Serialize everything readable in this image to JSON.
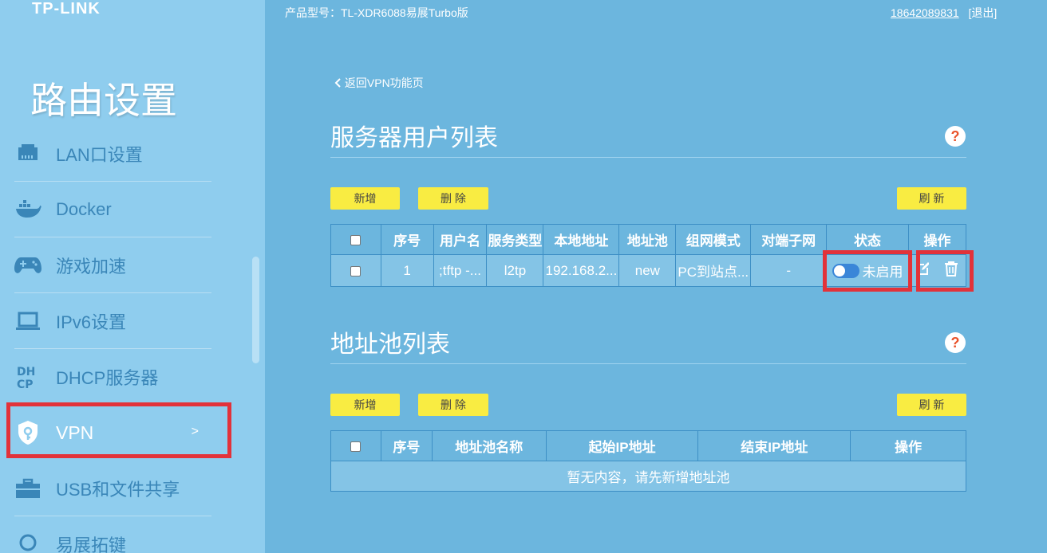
{
  "brand": "TP-LINK",
  "section_title": "路由设置",
  "topbar": {
    "model_label": "产品型号：TL-XDR6088易展Turbo版",
    "phone": "18642089831",
    "logout": "[退出]"
  },
  "nav": {
    "items": [
      {
        "label": "LAN口设置",
        "icon": "ethernet-port-icon"
      },
      {
        "label": "Docker",
        "icon": "docker-whale-icon"
      },
      {
        "label": "游戏加速",
        "icon": "gamepad-icon"
      },
      {
        "label": "IPv6设置",
        "icon": "laptop-icon"
      },
      {
        "label": "DHCP服务器",
        "icon": "dhcp-text-icon"
      },
      {
        "label": "VPN",
        "icon": "shield-key-icon",
        "arrow": ">"
      },
      {
        "label": "USB和文件共享",
        "icon": "briefcase-icon"
      },
      {
        "label": "易展拓键",
        "icon": "mesh-icon"
      }
    ]
  },
  "back_link": "返回VPN功能页",
  "users": {
    "title": "服务器用户列表",
    "help": "?",
    "add_label": "新增",
    "delete_label": "删 除",
    "refresh_label": "刷 新",
    "columns": [
      "序号",
      "用户名",
      "服务类型",
      "本地地址",
      "地址池",
      "组网模式",
      "对端子网",
      "状态",
      "操作"
    ],
    "rows": [
      {
        "index": "1",
        "username": ";tftp -...",
        "service": "l2tp",
        "local_addr": "192.168.2...",
        "pool": "new",
        "mode": "PC到站点...",
        "peer_subnet": "-",
        "status": "未启用"
      }
    ]
  },
  "pools": {
    "title": "地址池列表",
    "help": "?",
    "add_label": "新增",
    "delete_label": "删 除",
    "refresh_label": "刷 新",
    "columns": [
      "序号",
      "地址池名称",
      "起始IP地址",
      "结束IP地址",
      "操作"
    ],
    "empty_text": "暂无内容，请先新增地址池"
  },
  "colors": {
    "background": "#6cb6de",
    "sidebar": "#8fcdee",
    "button": "#f9ec42",
    "highlight": "#e2323a",
    "toggle": "#3a86d8"
  }
}
